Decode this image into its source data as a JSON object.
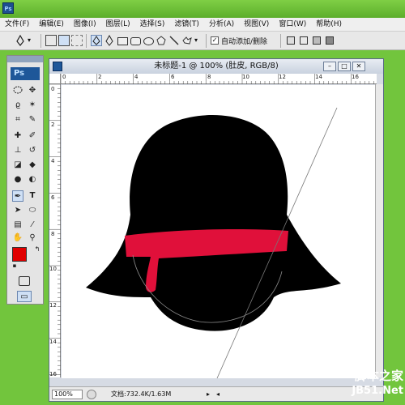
{
  "app": {
    "icon_label": "Ps"
  },
  "menu": [
    "文件(F)",
    "编辑(E)",
    "图像(I)",
    "图层(L)",
    "选择(S)",
    "滤镜(T)",
    "分析(A)",
    "视图(V)",
    "窗口(W)",
    "帮助(H)"
  ],
  "options": {
    "auto_add_delete_label": "自动添加/删除",
    "auto_add_delete_checked": true
  },
  "tools_panel": {
    "badge": "Ps"
  },
  "colors": {
    "foreground": "#e00000",
    "background": "#ffffff",
    "shape_black": "#000000",
    "band_red": "#e0103a"
  },
  "document": {
    "title": "未标题-1 @ 100% (肚皮, RGB/8)",
    "zoom": "100%",
    "info": "文档:732.4K/1.63M",
    "ruler_top": [
      "0",
      "2",
      "4",
      "6",
      "8",
      "10",
      "12",
      "14",
      "16"
    ],
    "ruler_left": [
      "0",
      "2",
      "4",
      "6",
      "8",
      "10",
      "12",
      "14",
      "16"
    ]
  },
  "watermark": {
    "line1": "脚本之家",
    "line2": "JB51.Net"
  }
}
